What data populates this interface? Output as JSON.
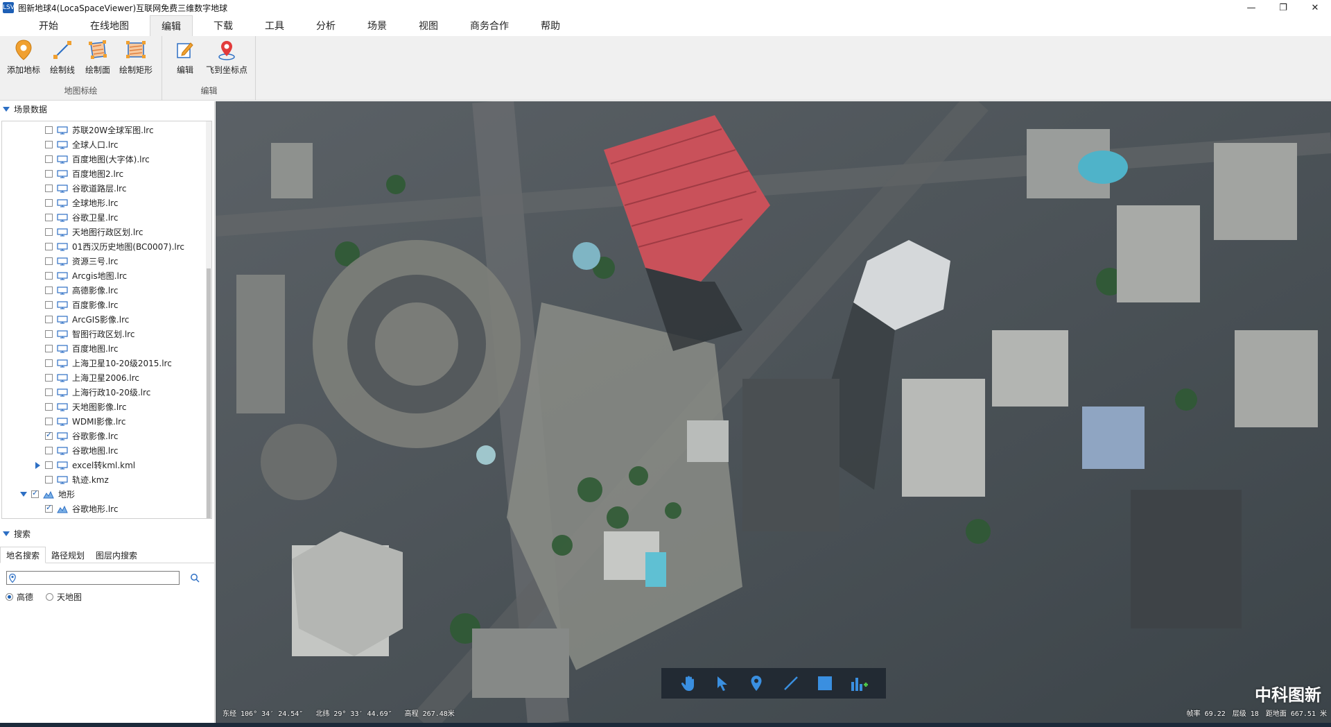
{
  "window": {
    "title": "图新地球4(LocaSpaceViewer)互联网免费三维数字地球",
    "app_icon_text": "LSV"
  },
  "tabs": [
    {
      "label": "开始"
    },
    {
      "label": "在线地图"
    },
    {
      "label": "编辑",
      "active": true
    },
    {
      "label": "下载"
    },
    {
      "label": "工具"
    },
    {
      "label": "分析"
    },
    {
      "label": "场景"
    },
    {
      "label": "视图"
    },
    {
      "label": "商务合作"
    },
    {
      "label": "帮助"
    }
  ],
  "ribbon": {
    "groups": [
      {
        "name": "地图标绘",
        "buttons": [
          {
            "label": "添加地标",
            "icon": "placemark-icon"
          },
          {
            "label": "绘制线",
            "icon": "draw-line-icon"
          },
          {
            "label": "绘制面",
            "icon": "draw-polygon-icon"
          },
          {
            "label": "绘制矩形",
            "icon": "draw-rectangle-icon"
          }
        ]
      },
      {
        "name": "编辑",
        "buttons": [
          {
            "label": "编辑",
            "icon": "edit-icon"
          },
          {
            "label": "飞到坐标点",
            "icon": "fly-to-point-icon"
          }
        ]
      }
    ]
  },
  "scene_data": {
    "header": "场景数据",
    "layers": [
      {
        "label": "苏联20W全球军图.lrc",
        "checked": false,
        "type": "map"
      },
      {
        "label": "全球人口.lrc",
        "checked": false,
        "type": "map"
      },
      {
        "label": "百度地图(大字体).lrc",
        "checked": false,
        "type": "map"
      },
      {
        "label": "百度地图2.lrc",
        "checked": false,
        "type": "map"
      },
      {
        "label": "谷歌道路层.lrc",
        "checked": false,
        "type": "map"
      },
      {
        "label": "全球地形.lrc",
        "checked": false,
        "type": "map"
      },
      {
        "label": "谷歌卫星.lrc",
        "checked": false,
        "type": "map"
      },
      {
        "label": "天地图行政区划.lrc",
        "checked": false,
        "type": "map"
      },
      {
        "label": "01西汉历史地图(BC0007).lrc",
        "checked": false,
        "type": "map"
      },
      {
        "label": "资源三号.lrc",
        "checked": false,
        "type": "map"
      },
      {
        "label": "Arcgis地图.lrc",
        "checked": false,
        "type": "map"
      },
      {
        "label": "高德影像.lrc",
        "checked": false,
        "type": "map"
      },
      {
        "label": "百度影像.lrc",
        "checked": false,
        "type": "map"
      },
      {
        "label": "ArcGIS影像.lrc",
        "checked": false,
        "type": "map"
      },
      {
        "label": "智图行政区划.lrc",
        "checked": false,
        "type": "map"
      },
      {
        "label": "百度地图.lrc",
        "checked": false,
        "type": "map"
      },
      {
        "label": "上海卫星10-20级2015.lrc",
        "checked": false,
        "type": "map"
      },
      {
        "label": "上海卫星2006.lrc",
        "checked": false,
        "type": "map"
      },
      {
        "label": "上海行政10-20级.lrc",
        "checked": false,
        "type": "map"
      },
      {
        "label": "天地图影像.lrc",
        "checked": false,
        "type": "map"
      },
      {
        "label": "WDMI影像.lrc",
        "checked": false,
        "type": "map"
      },
      {
        "label": "谷歌影像.lrc",
        "checked": true,
        "type": "map"
      },
      {
        "label": "谷歌地图.lrc",
        "checked": false,
        "type": "map"
      },
      {
        "label": "excel转kml.kml",
        "checked": false,
        "type": "map",
        "expandable": true
      },
      {
        "label": "轨迹.kmz",
        "checked": false,
        "type": "map"
      }
    ],
    "terrain_group": {
      "label": "地形",
      "checked": true
    },
    "terrain_layers": [
      {
        "label": "谷歌地形.lrc",
        "checked": true
      }
    ]
  },
  "search": {
    "header": "搜索",
    "tabs": [
      "地名搜索",
      "路径规划",
      "图层内搜索"
    ],
    "active_tab": 0,
    "input_value": "",
    "input_placeholder": "",
    "providers": [
      {
        "label": "高德",
        "selected": true
      },
      {
        "label": "天地图",
        "selected": false
      }
    ]
  },
  "map": {
    "watermark": "中科图新",
    "tools": [
      "pan-hand-icon",
      "select-arrow-icon",
      "placemark-icon",
      "line-icon",
      "rectangle-icon",
      "chart-add-icon"
    ],
    "status": {
      "lon": "东经 106° 34′ 24.54″",
      "lat": "北纬 29° 33′ 44.69″",
      "elev": "高程 267.48米",
      "fps": "帧率 69.22",
      "level": "层级 18",
      "distance": "距地面 667.51 米"
    }
  }
}
